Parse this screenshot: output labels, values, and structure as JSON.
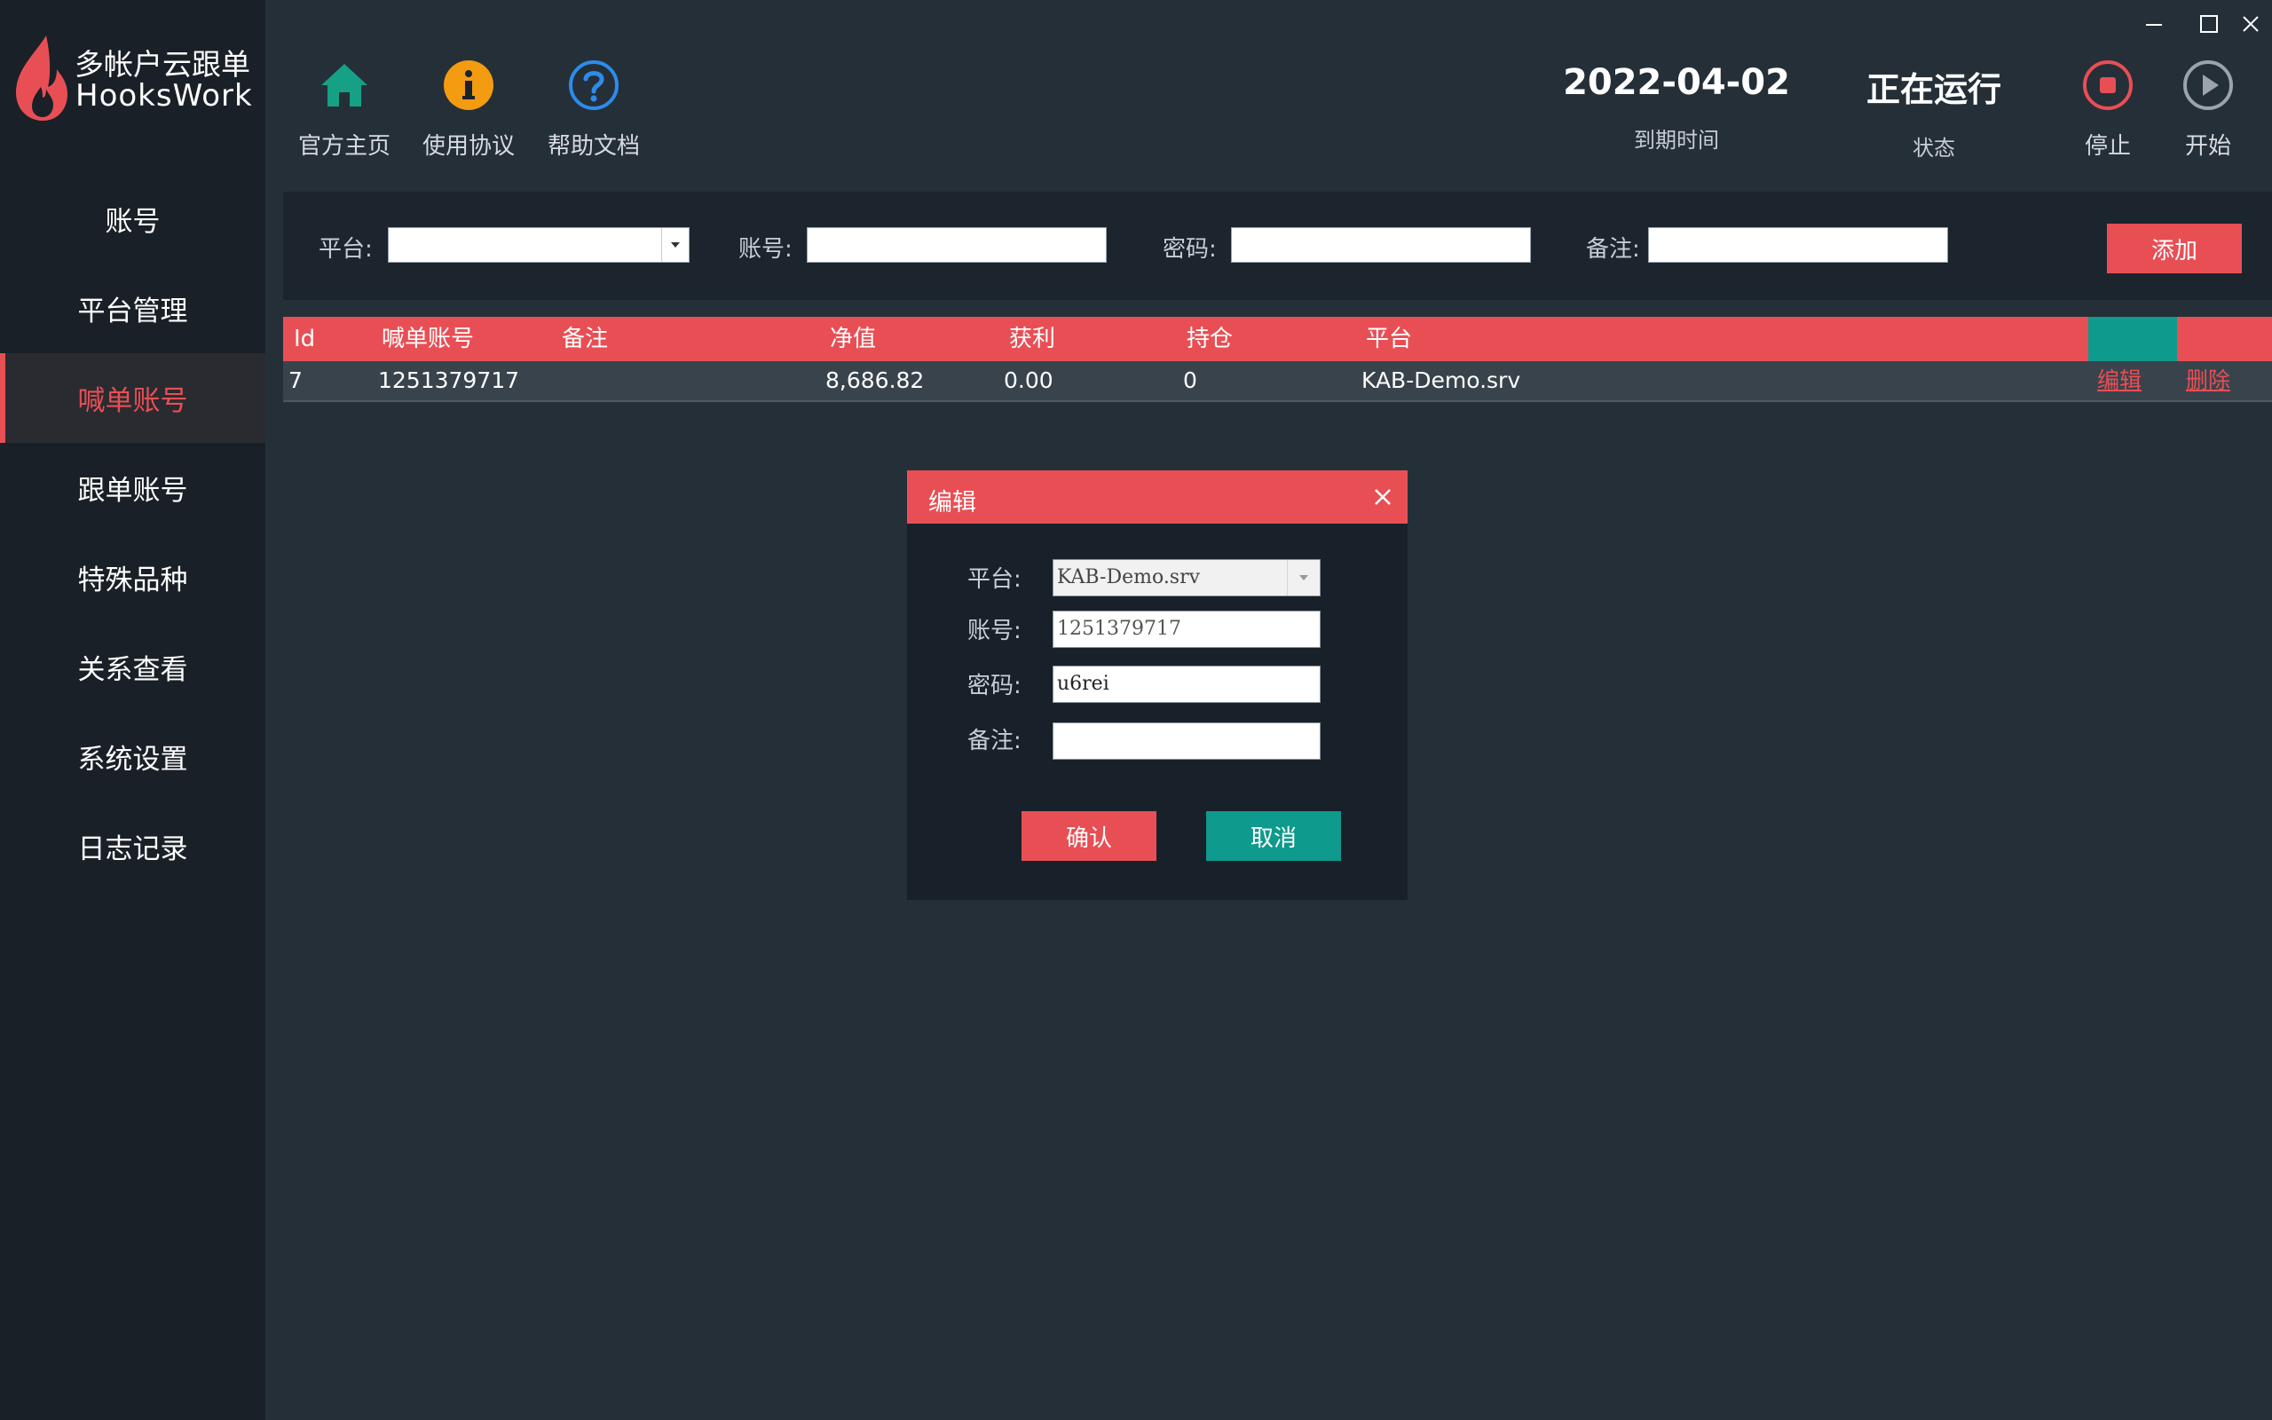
{
  "app": {
    "name_cn": "多帐户云跟单",
    "name_en": "HooksWork"
  },
  "sidebar": {
    "items": [
      {
        "label": "账号"
      },
      {
        "label": "平台管理"
      },
      {
        "label": "喊单账号",
        "active": true
      },
      {
        "label": "跟单账号"
      },
      {
        "label": "特殊品种"
      },
      {
        "label": "关系查看"
      },
      {
        "label": "系统设置"
      },
      {
        "label": "日志记录"
      }
    ]
  },
  "toolbar": {
    "home_label": "官方主页",
    "agreement_label": "使用协议",
    "help_label": "帮助文档",
    "expiry_value": "2022-04-02",
    "expiry_caption": "到期时间",
    "status_value": "正在运行",
    "status_caption": "状态",
    "stop_label": "停止",
    "start_label": "开始",
    "icons": {
      "home": "home-icon",
      "agreement": "info-icon",
      "help": "question-icon",
      "stop": "stop-icon",
      "start": "play-icon"
    }
  },
  "filter": {
    "platform_label": "平台:",
    "platform_value": "",
    "account_label": "账号:",
    "account_value": "",
    "password_label": "密码:",
    "password_value": "",
    "note_label": "备注:",
    "note_value": "",
    "add_label": "添加"
  },
  "table": {
    "headers": [
      "Id",
      "喊单账号",
      "备注",
      "净值",
      "获利",
      "持仓",
      "平台"
    ],
    "rows": [
      {
        "id": "7",
        "account": "1251379717",
        "note": "",
        "equity": "8,686.82",
        "profit": "0.00",
        "positions": "0",
        "platform": "KAB-Demo.srv",
        "edit": "编辑",
        "delete": "删除"
      }
    ]
  },
  "dialog": {
    "title": "编辑",
    "platform_label": "平台:",
    "platform_value": "KAB-Demo.srv",
    "account_label": "账号:",
    "account_value": "1251379717",
    "password_label": "密码:",
    "password_value": "u6rei",
    "note_label": "备注:",
    "note_value": "",
    "confirm_label": "确认",
    "cancel_label": "取消"
  },
  "colors": {
    "accent_red": "#e84f55",
    "accent_teal": "#0e9a8c",
    "home_green": "#16a085",
    "info_orange": "#f39c12",
    "help_blue": "#2d8ceb"
  }
}
